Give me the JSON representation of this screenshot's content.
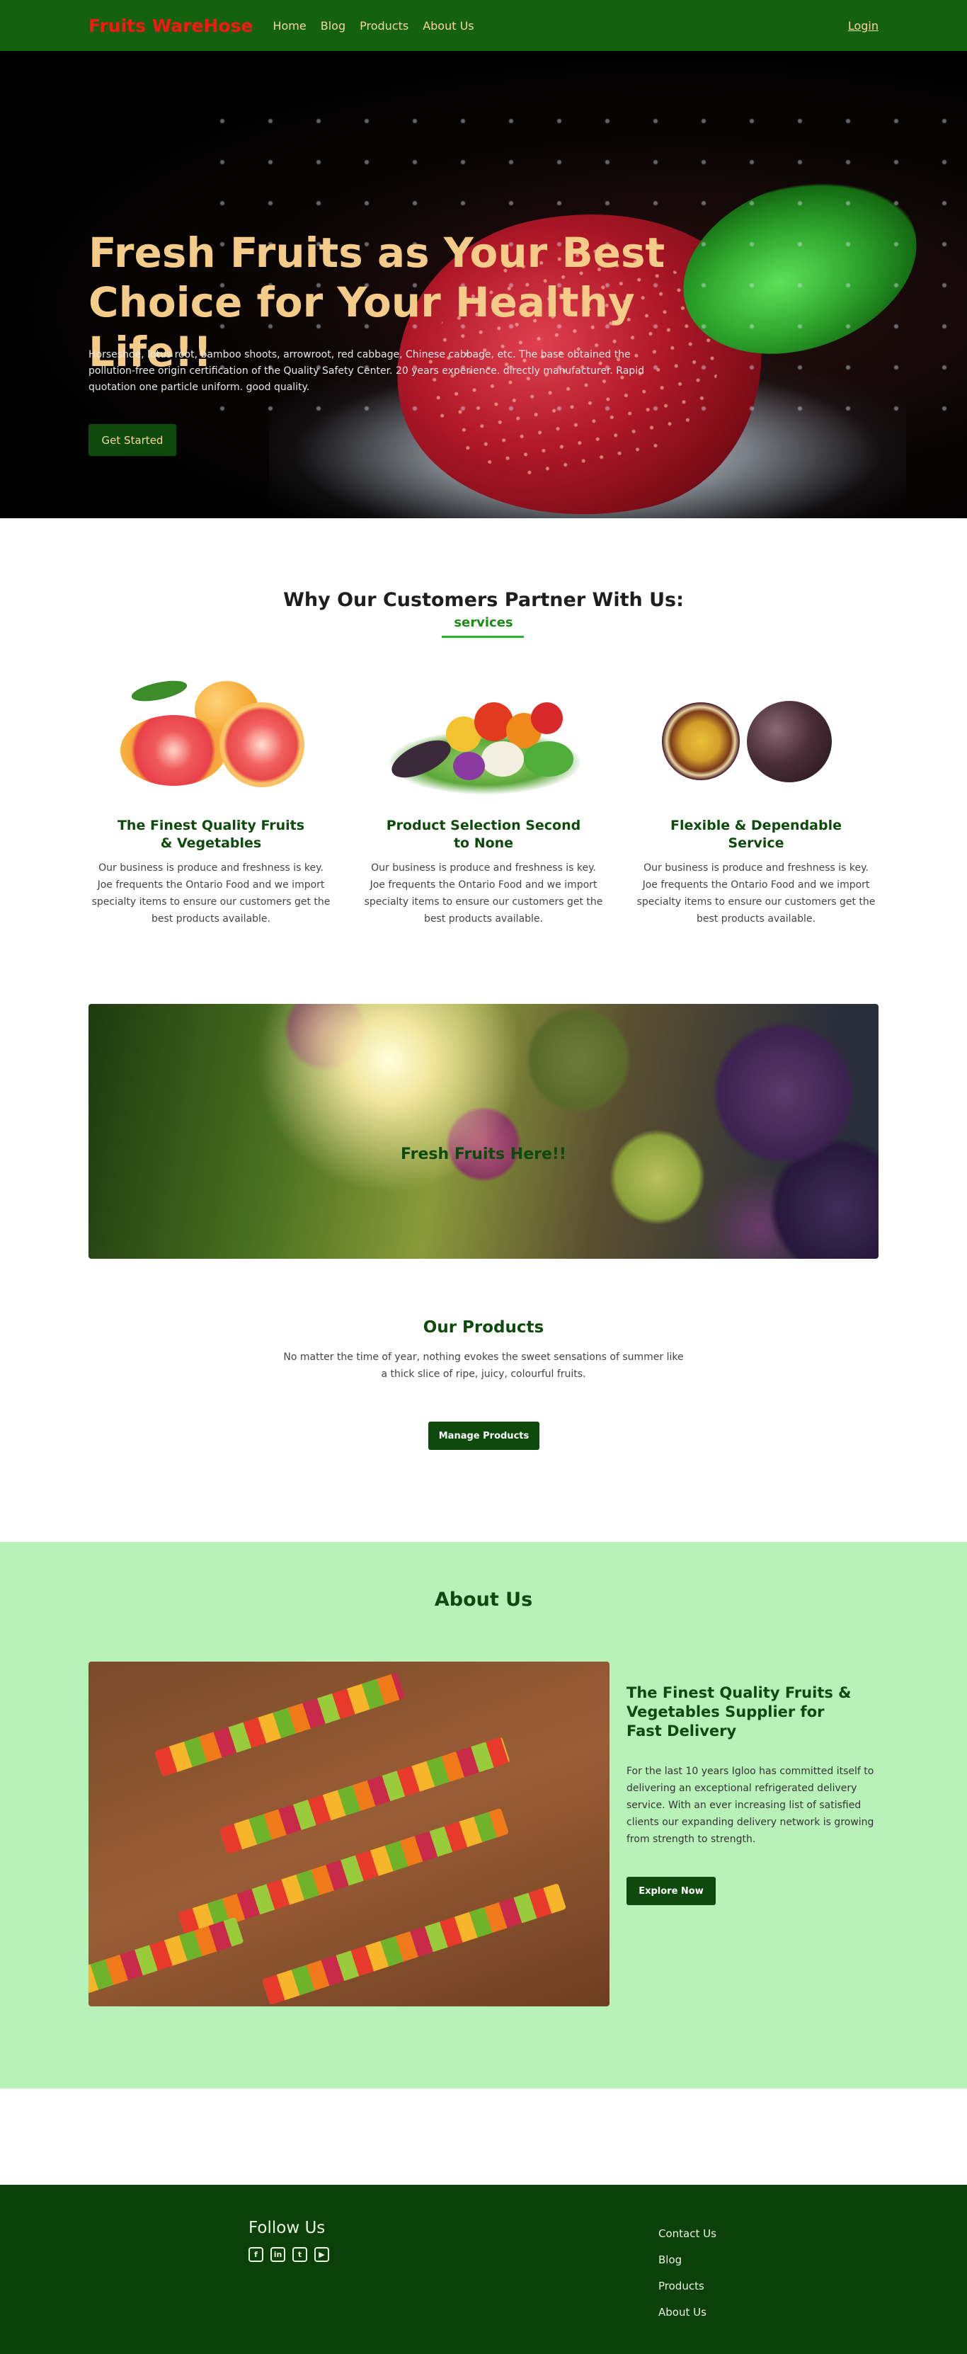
{
  "navbar": {
    "brand": "Fruits WareHose",
    "links": [
      "Home",
      "Blog",
      "Products",
      "About Us"
    ],
    "login": "Login"
  },
  "hero": {
    "title": "Fresh Fruits as Your Best Choice for Your Healthy Life!!",
    "text": "Horseshoe, lotus root, bamboo shoots, arrowroot, red cabbage, Chinese cabbage, etc. The base obtained the pollution-free origin certification of the Quality Safety Center. 20 years experience. directly manufacturer. Rapid quotation one particle uniform. good quality.",
    "button": "Get Started"
  },
  "services": {
    "title": "Why Our Customers Partner With Us:",
    "subtitle": "services",
    "cards": [
      {
        "title": "The Finest Quality Fruits & Vegetables",
        "text": "Our business is produce and freshness is key. Joe frequents the Ontario Food and we import specialty items to ensure our customers get the best products available."
      },
      {
        "title": "Product Selection Second to None",
        "text": "Our business is produce and freshness is key. Joe frequents the Ontario Food and we import specialty items to ensure our customers get the best products available."
      },
      {
        "title": "Flexible & Dependable Service",
        "text": "Our business is produce and freshness is key. Joe frequents the Ontario Food and we import specialty items to ensure our customers get the best products available."
      }
    ]
  },
  "banner": {
    "text": "Fresh Fruits Here!!"
  },
  "products": {
    "title": "Our Products",
    "text": "No matter the time of year, nothing evokes the sweet sensations of summer like a thick slice of ripe, juicy, colourful fruits.",
    "button": "Manage Products"
  },
  "about": {
    "title": "About Us",
    "subtitle": "The Finest Quality Fruits & Vegetables Supplier for Fast Delivery",
    "text": "For the last 10 years Igloo has committed itself to delivering an exceptional refrigerated delivery service. With an ever increasing list of satisfied clients our expanding delivery network is growing from strength to strength.",
    "button": "Explore Now"
  },
  "footer": {
    "follow": "Follow Us",
    "social": [
      "facebook-icon",
      "linkedin-icon",
      "twitter-icon",
      "youtube-icon"
    ],
    "links": [
      "Contact Us",
      "Blog",
      "Products",
      "About Us"
    ]
  },
  "colors": {
    "nav_bg": "#14620f",
    "brand": "#ff1414",
    "accent_dark": "#0e4a0c",
    "hero_title": "#f5cb8a",
    "services_sub": "#1d8a1a",
    "about_bg": "#b9f2b9",
    "footer_bg": "#0b4108"
  }
}
